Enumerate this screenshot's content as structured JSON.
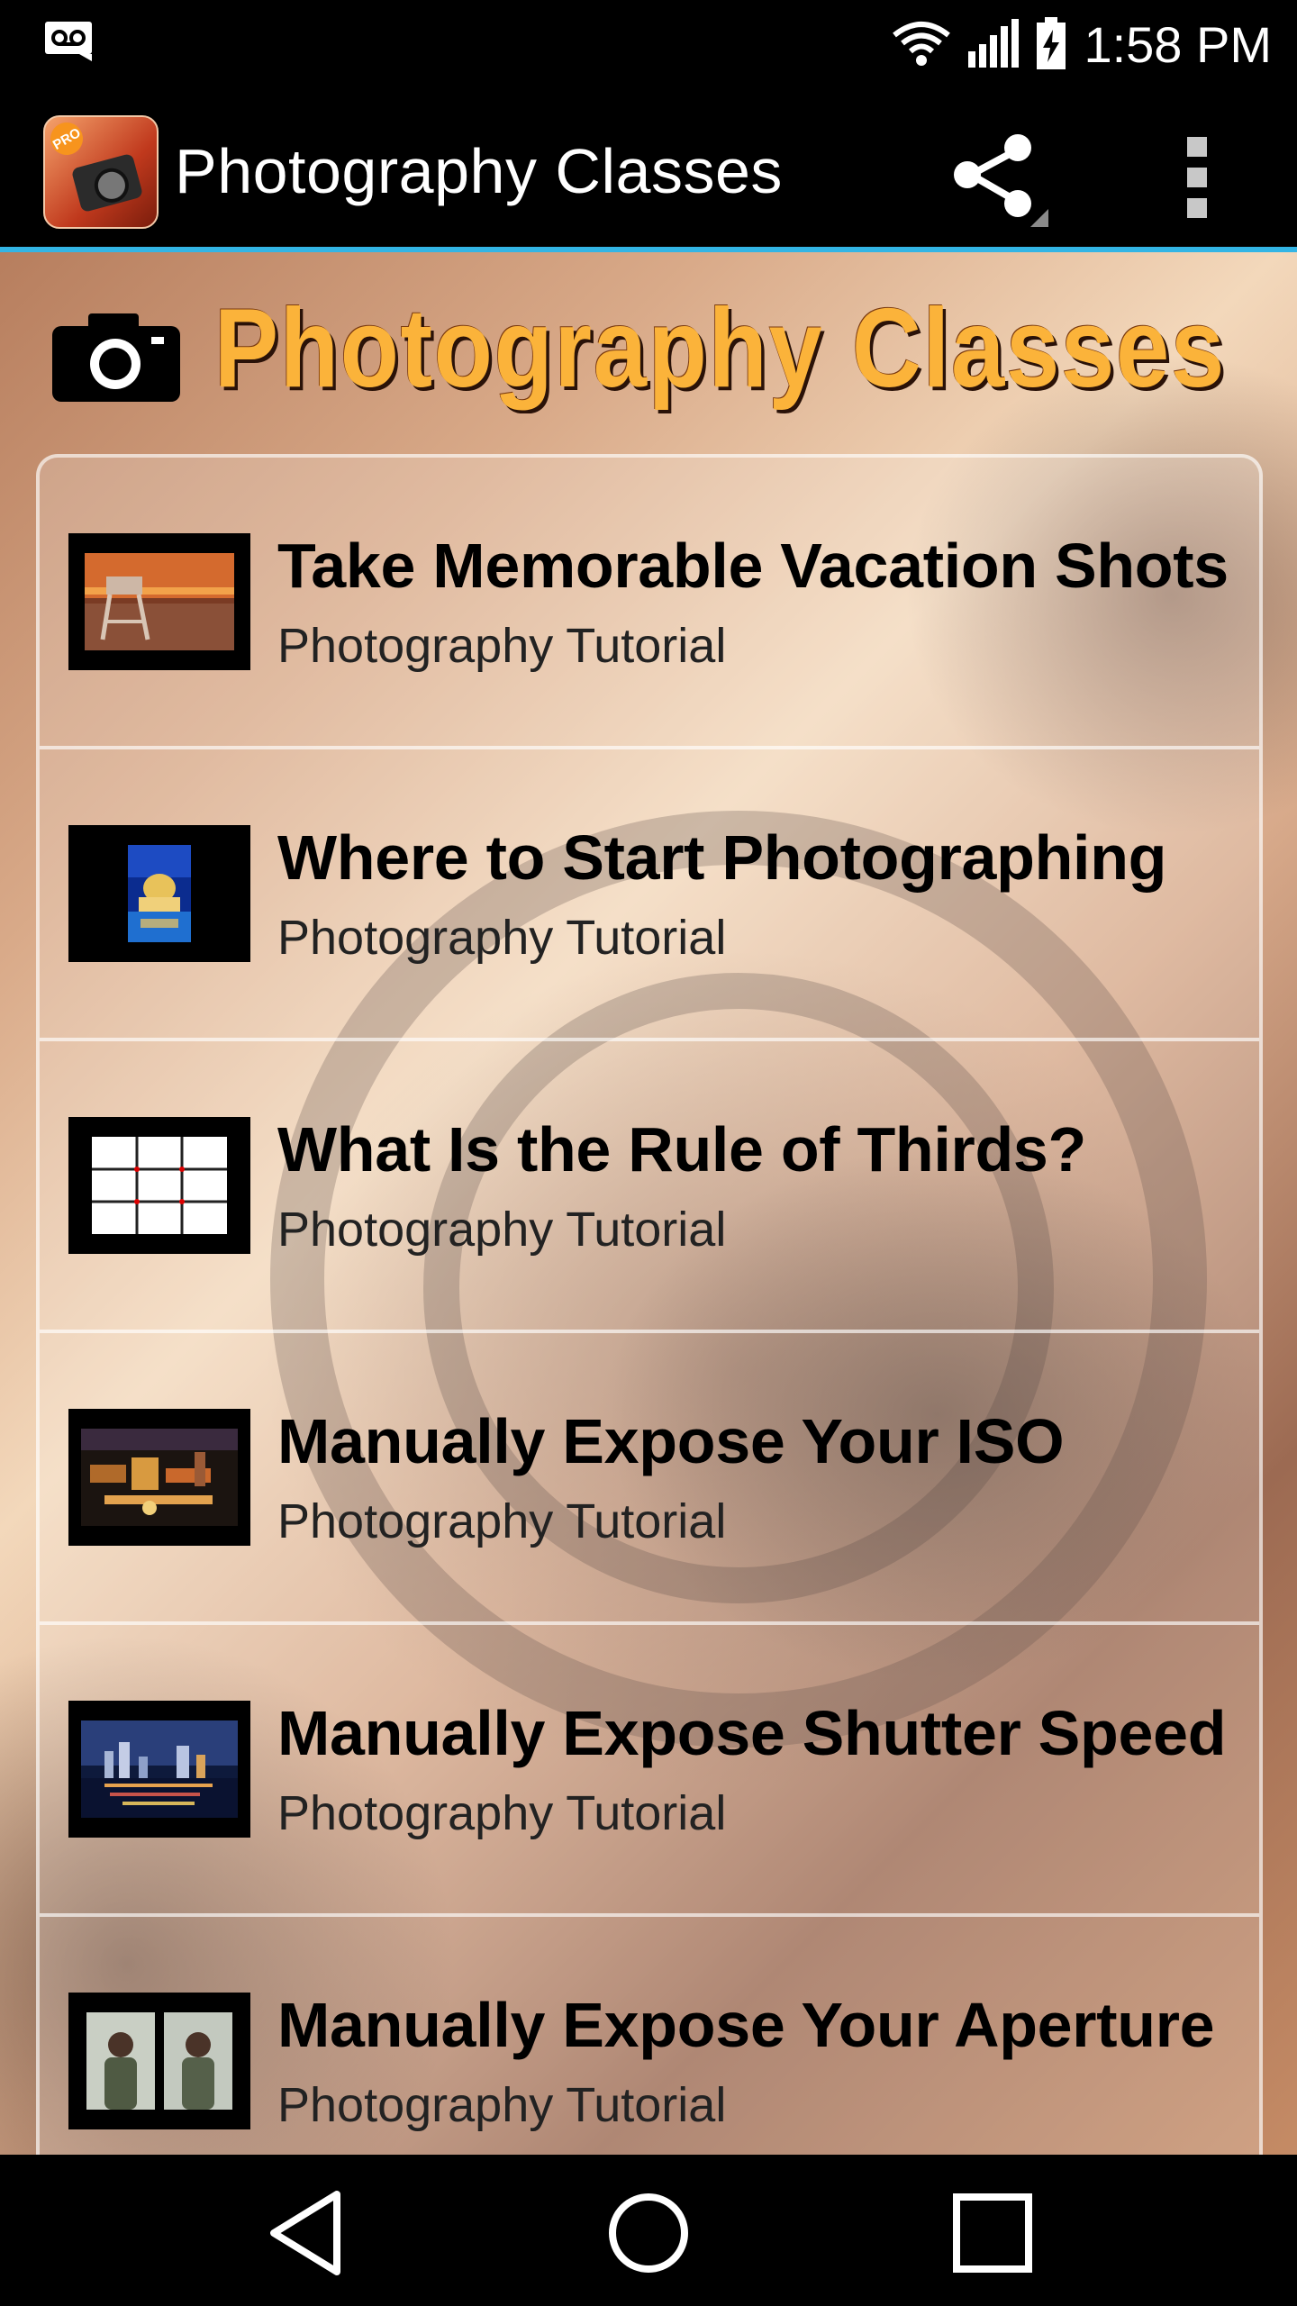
{
  "status_bar": {
    "time": "1:58 PM",
    "icons": [
      "voicemail-icon",
      "wifi-icon",
      "signal-icon",
      "battery-charging-icon"
    ]
  },
  "action_bar": {
    "app_icon": "app-icon",
    "app_icon_badge": "PRO",
    "title": "Photography Classes",
    "share_icon": "share-icon",
    "overflow_icon": "overflow-menu-icon"
  },
  "banner": {
    "camera_icon": "camera-icon",
    "title": "Photography Classes"
  },
  "lessons": [
    {
      "title": "Take Memorable Vacation Shots",
      "subtitle": "Photography Tutorial",
      "thumbnail": "beach-lifeguard-sunset-thumbnail"
    },
    {
      "title": "Where to Start Photographing",
      "subtitle": "Photography Tutorial",
      "thumbnail": "capitol-night-reflection-thumbnail"
    },
    {
      "title": "What Is the Rule of Thirds?",
      "subtitle": "Photography Tutorial",
      "thumbnail": "rule-of-thirds-grid-thumbnail"
    },
    {
      "title": "Manually Expose Your ISO",
      "subtitle": "Photography Tutorial",
      "thumbnail": "city-lights-aerial-thumbnail"
    },
    {
      "title": "Manually Expose Shutter Speed",
      "subtitle": "Photography Tutorial",
      "thumbnail": "skyline-night-reflection-thumbnail"
    },
    {
      "title": "Manually Expose Your Aperture",
      "subtitle": "Photography Tutorial",
      "thumbnail": "two-portraits-thumbnail"
    }
  ],
  "nav_bar": {
    "back_icon": "back-icon",
    "home_icon": "home-icon",
    "recents_icon": "recents-icon"
  },
  "colors": {
    "accent": "#33b5e5",
    "banner_title": "#fbb33a",
    "bar_background": "#000000"
  }
}
